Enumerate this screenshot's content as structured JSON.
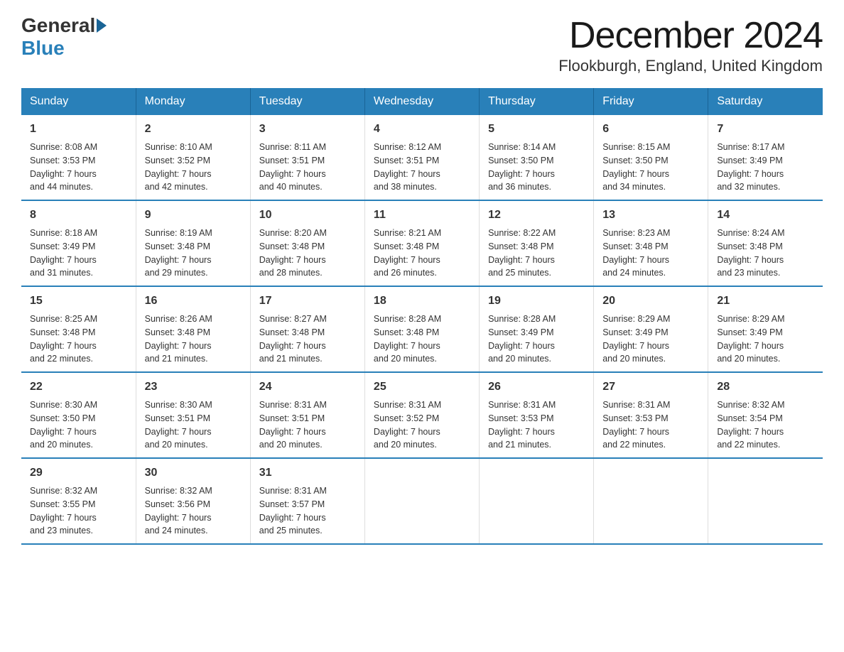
{
  "header": {
    "logo_general": "General",
    "logo_blue": "Blue",
    "month_title": "December 2024",
    "location": "Flookburgh, England, United Kingdom"
  },
  "weekdays": [
    "Sunday",
    "Monday",
    "Tuesday",
    "Wednesday",
    "Thursday",
    "Friday",
    "Saturday"
  ],
  "weeks": [
    [
      {
        "day": "1",
        "info": "Sunrise: 8:08 AM\nSunset: 3:53 PM\nDaylight: 7 hours\nand 44 minutes."
      },
      {
        "day": "2",
        "info": "Sunrise: 8:10 AM\nSunset: 3:52 PM\nDaylight: 7 hours\nand 42 minutes."
      },
      {
        "day": "3",
        "info": "Sunrise: 8:11 AM\nSunset: 3:51 PM\nDaylight: 7 hours\nand 40 minutes."
      },
      {
        "day": "4",
        "info": "Sunrise: 8:12 AM\nSunset: 3:51 PM\nDaylight: 7 hours\nand 38 minutes."
      },
      {
        "day": "5",
        "info": "Sunrise: 8:14 AM\nSunset: 3:50 PM\nDaylight: 7 hours\nand 36 minutes."
      },
      {
        "day": "6",
        "info": "Sunrise: 8:15 AM\nSunset: 3:50 PM\nDaylight: 7 hours\nand 34 minutes."
      },
      {
        "day": "7",
        "info": "Sunrise: 8:17 AM\nSunset: 3:49 PM\nDaylight: 7 hours\nand 32 minutes."
      }
    ],
    [
      {
        "day": "8",
        "info": "Sunrise: 8:18 AM\nSunset: 3:49 PM\nDaylight: 7 hours\nand 31 minutes."
      },
      {
        "day": "9",
        "info": "Sunrise: 8:19 AM\nSunset: 3:48 PM\nDaylight: 7 hours\nand 29 minutes."
      },
      {
        "day": "10",
        "info": "Sunrise: 8:20 AM\nSunset: 3:48 PM\nDaylight: 7 hours\nand 28 minutes."
      },
      {
        "day": "11",
        "info": "Sunrise: 8:21 AM\nSunset: 3:48 PM\nDaylight: 7 hours\nand 26 minutes."
      },
      {
        "day": "12",
        "info": "Sunrise: 8:22 AM\nSunset: 3:48 PM\nDaylight: 7 hours\nand 25 minutes."
      },
      {
        "day": "13",
        "info": "Sunrise: 8:23 AM\nSunset: 3:48 PM\nDaylight: 7 hours\nand 24 minutes."
      },
      {
        "day": "14",
        "info": "Sunrise: 8:24 AM\nSunset: 3:48 PM\nDaylight: 7 hours\nand 23 minutes."
      }
    ],
    [
      {
        "day": "15",
        "info": "Sunrise: 8:25 AM\nSunset: 3:48 PM\nDaylight: 7 hours\nand 22 minutes."
      },
      {
        "day": "16",
        "info": "Sunrise: 8:26 AM\nSunset: 3:48 PM\nDaylight: 7 hours\nand 21 minutes."
      },
      {
        "day": "17",
        "info": "Sunrise: 8:27 AM\nSunset: 3:48 PM\nDaylight: 7 hours\nand 21 minutes."
      },
      {
        "day": "18",
        "info": "Sunrise: 8:28 AM\nSunset: 3:48 PM\nDaylight: 7 hours\nand 20 minutes."
      },
      {
        "day": "19",
        "info": "Sunrise: 8:28 AM\nSunset: 3:49 PM\nDaylight: 7 hours\nand 20 minutes."
      },
      {
        "day": "20",
        "info": "Sunrise: 8:29 AM\nSunset: 3:49 PM\nDaylight: 7 hours\nand 20 minutes."
      },
      {
        "day": "21",
        "info": "Sunrise: 8:29 AM\nSunset: 3:49 PM\nDaylight: 7 hours\nand 20 minutes."
      }
    ],
    [
      {
        "day": "22",
        "info": "Sunrise: 8:30 AM\nSunset: 3:50 PM\nDaylight: 7 hours\nand 20 minutes."
      },
      {
        "day": "23",
        "info": "Sunrise: 8:30 AM\nSunset: 3:51 PM\nDaylight: 7 hours\nand 20 minutes."
      },
      {
        "day": "24",
        "info": "Sunrise: 8:31 AM\nSunset: 3:51 PM\nDaylight: 7 hours\nand 20 minutes."
      },
      {
        "day": "25",
        "info": "Sunrise: 8:31 AM\nSunset: 3:52 PM\nDaylight: 7 hours\nand 20 minutes."
      },
      {
        "day": "26",
        "info": "Sunrise: 8:31 AM\nSunset: 3:53 PM\nDaylight: 7 hours\nand 21 minutes."
      },
      {
        "day": "27",
        "info": "Sunrise: 8:31 AM\nSunset: 3:53 PM\nDaylight: 7 hours\nand 22 minutes."
      },
      {
        "day": "28",
        "info": "Sunrise: 8:32 AM\nSunset: 3:54 PM\nDaylight: 7 hours\nand 22 minutes."
      }
    ],
    [
      {
        "day": "29",
        "info": "Sunrise: 8:32 AM\nSunset: 3:55 PM\nDaylight: 7 hours\nand 23 minutes."
      },
      {
        "day": "30",
        "info": "Sunrise: 8:32 AM\nSunset: 3:56 PM\nDaylight: 7 hours\nand 24 minutes."
      },
      {
        "day": "31",
        "info": "Sunrise: 8:31 AM\nSunset: 3:57 PM\nDaylight: 7 hours\nand 25 minutes."
      },
      {
        "day": "",
        "info": ""
      },
      {
        "day": "",
        "info": ""
      },
      {
        "day": "",
        "info": ""
      },
      {
        "day": "",
        "info": ""
      }
    ]
  ]
}
